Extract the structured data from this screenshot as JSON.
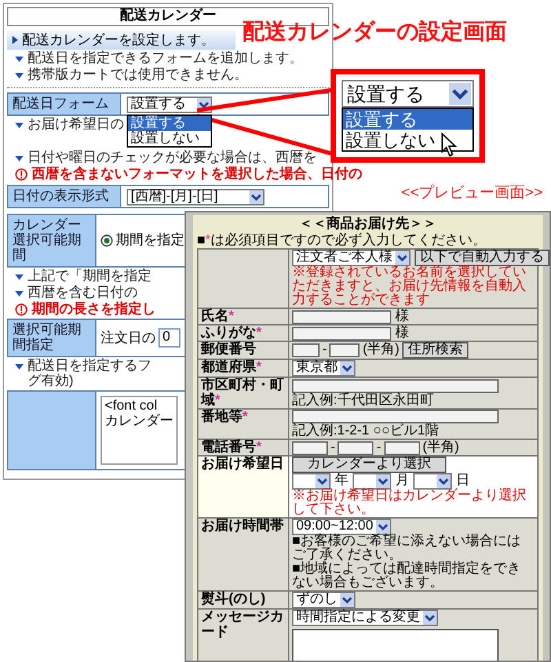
{
  "annotation": {
    "heading": "配送カレンダーの設定画面",
    "preview_label": "<<プレビュー画面>>"
  },
  "admin": {
    "title": "配送カレンダー",
    "intro": "配送カレンダーを設定します。",
    "notes_top": [
      {
        "kind": "info",
        "text": "配送日を指定できるフォームを追加します。"
      },
      {
        "kind": "info",
        "text": "携帯版カートでは使用できません。"
      }
    ],
    "delivery_form": {
      "label": "配送日フォーム",
      "value": "設置する",
      "options": [
        {
          "label": "設置する",
          "selected": true
        },
        {
          "label": "設置しない",
          "selected": false
        }
      ]
    },
    "notes_mid": [
      {
        "kind": "info",
        "text": "お届け希望日の"
      },
      {
        "kind": "info",
        "text": "日付や曜日のチェックが必要な場合は、西暦を"
      },
      {
        "kind": "warning",
        "text": "西暦を含まないフォーマットを選択した場合、日付の"
      }
    ],
    "date_format": {
      "label": "日付の表示形式",
      "value": "[西暦]-[月]-[日]"
    },
    "period": {
      "label": "カレンダー選択可能期間",
      "options": [
        {
          "label": "期間を指定",
          "selected": true
        }
      ]
    },
    "notes_low": [
      {
        "kind": "info",
        "text": "上記で「期間を指定"
      },
      {
        "kind": "info",
        "text": "西暦を含む日付の"
      },
      {
        "kind": "warning",
        "text": "期間の長さを指定し"
      }
    ],
    "range": {
      "label": "選択可能期間指定",
      "prefix": "注文日の",
      "value": "0"
    },
    "message_note": {
      "kind": "info",
      "lines": [
        "配送日を指定するフ",
        "グ有効)"
      ]
    },
    "message_box": {
      "lines": [
        "<font col",
        "カレンダー"
      ]
    }
  },
  "callout": {
    "value": "設置する",
    "options": [
      {
        "label": "設置する",
        "selected": true
      },
      {
        "label": "設置しない",
        "selected": false
      }
    ]
  },
  "preview": {
    "title": "＜＜商品お届け先＞＞",
    "note": {
      "bullet": "■",
      "mark": "*",
      "text": "は必須項目ですので必ず入力してください。"
    },
    "rows": [
      {
        "kind": "autofill",
        "label": "",
        "highlighted": false,
        "select": "注文者ご本人様",
        "button": "以下で自動入力する",
        "note": "※登録されているお名前を選択していただきますと、お届け先情報を自動入力することができます"
      },
      {
        "kind": "name",
        "label": "氏名",
        "mark": "*",
        "highlighted": false,
        "suffix": "様"
      },
      {
        "kind": "name",
        "label": "ふりがな",
        "mark": "*",
        "highlighted": false,
        "suffix": "様"
      },
      {
        "kind": "zip",
        "label": "郵便番号",
        "highlighted": false,
        "separator": "-",
        "hint": "(半角)",
        "button": "住所検索"
      },
      {
        "kind": "select",
        "label": "都道府県",
        "mark": "*",
        "highlighted": false,
        "value": "東京都"
      },
      {
        "kind": "address",
        "label": "市区町村・町域",
        "mark": "*",
        "highlighted": false,
        "example": "記入例:千代田区永田町"
      },
      {
        "kind": "address",
        "label": "番地等",
        "mark": "*",
        "highlighted": false,
        "example": "記入例:1-2-1 ○○ビル1階"
      },
      {
        "kind": "phone",
        "label": "電話番号",
        "mark": "*",
        "highlighted": false,
        "separators": [
          "-",
          "-"
        ],
        "hint": "(半角)"
      },
      {
        "kind": "date",
        "label": "お届け希望日",
        "highlighted": true,
        "button": "カレンダーより選択",
        "units": [
          "年",
          "月",
          "日"
        ],
        "note": "※お届け希望日はカレンダーより選択して下さい。"
      },
      {
        "kind": "time",
        "label": "お届け時間帯",
        "highlighted": false,
        "value": "09:00~12:00",
        "notes": [
          "■お客様のご希望に添えない場合にはご了承ください。",
          "■地域によっては配達時間指定をできない場合もございます。"
        ]
      },
      {
        "kind": "select",
        "label": "熨斗(のし)",
        "highlighted": false,
        "value": "ずのし"
      },
      {
        "kind": "message",
        "label": "メッセージカード",
        "highlighted": false,
        "value": "時間指定による変更"
      }
    ]
  }
}
